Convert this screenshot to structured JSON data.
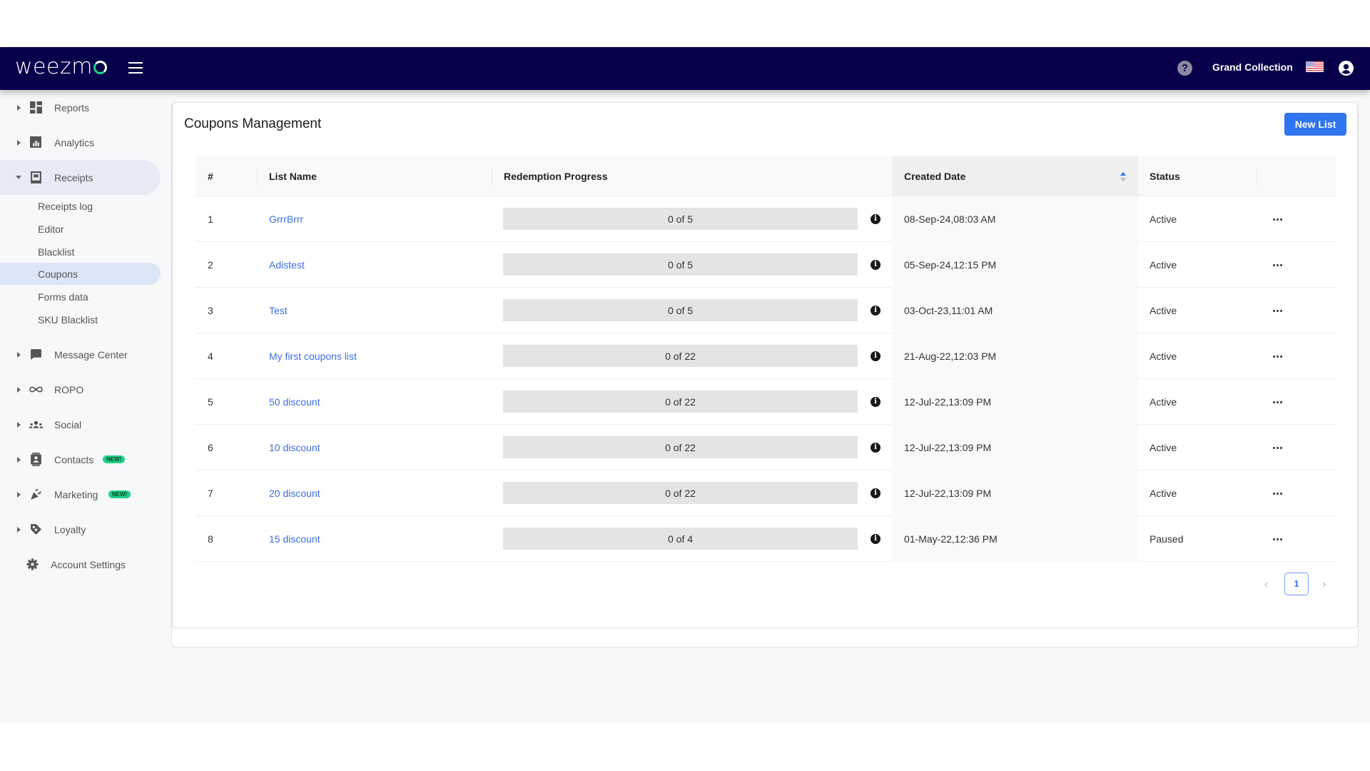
{
  "header": {
    "logo_text": "weezm",
    "account_name": "Grand Collection",
    "icons": [
      "menu-icon",
      "help-icon",
      "us-flag-icon",
      "user-account-icon"
    ]
  },
  "sidebar": {
    "items": [
      {
        "label": "Reports",
        "icon": "dashboard-icon",
        "expanded": false
      },
      {
        "label": "Analytics",
        "icon": "bar-chart-icon",
        "expanded": false
      },
      {
        "label": "Receipts",
        "icon": "receipt-icon",
        "expanded": true
      },
      {
        "label": "Message Center",
        "icon": "chat-icon",
        "expanded": false
      },
      {
        "label": "ROPO",
        "icon": "infinity-icon",
        "expanded": false
      },
      {
        "label": "Social",
        "icon": "people-icon",
        "expanded": false
      },
      {
        "label": "Contacts",
        "icon": "contact-card-icon",
        "expanded": false,
        "badge": "NEW!"
      },
      {
        "label": "Marketing",
        "icon": "party-popper-icon",
        "expanded": false,
        "badge": "NEW!"
      },
      {
        "label": "Loyalty",
        "icon": "tag-icon",
        "expanded": false
      },
      {
        "label": "Account Settings",
        "icon": "gear-icon"
      }
    ],
    "receipts_sub": [
      {
        "label": "Receipts log"
      },
      {
        "label": "Editor"
      },
      {
        "label": "Blacklist"
      },
      {
        "label": "Coupons",
        "active": true
      },
      {
        "label": "Forms data"
      },
      {
        "label": "SKU Blacklist"
      }
    ]
  },
  "main": {
    "title": "Coupons Management",
    "new_list_label": "New List",
    "table": {
      "columns": [
        "#",
        "List Name",
        "Redemption Progress",
        "Created Date",
        "Status"
      ],
      "sorted_by": "Created Date",
      "rows": [
        {
          "num": "1",
          "name": "GrrrBrrr",
          "progress_text": "0 of 5",
          "redeemed": 0,
          "total": 5,
          "created": "08-Sep-24,08:03 AM",
          "status": "Active"
        },
        {
          "num": "2",
          "name": "Adistest",
          "progress_text": "0 of 5",
          "redeemed": 0,
          "total": 5,
          "created": "05-Sep-24,12:15 PM",
          "status": "Active"
        },
        {
          "num": "3",
          "name": "Test",
          "progress_text": "0 of 5",
          "redeemed": 0,
          "total": 5,
          "created": "03-Oct-23,11:01 AM",
          "status": "Active"
        },
        {
          "num": "4",
          "name": "My first coupons list",
          "progress_text": "0 of 22",
          "redeemed": 0,
          "total": 22,
          "created": "21-Aug-22,12:03 PM",
          "status": "Active"
        },
        {
          "num": "5",
          "name": "50 discount",
          "progress_text": "0 of 22",
          "redeemed": 0,
          "total": 22,
          "created": "12-Jul-22,13:09 PM",
          "status": "Active"
        },
        {
          "num": "6",
          "name": "10 discount",
          "progress_text": "0 of 22",
          "redeemed": 0,
          "total": 22,
          "created": "12-Jul-22,13:09 PM",
          "status": "Active"
        },
        {
          "num": "7",
          "name": "20 discount",
          "progress_text": "0 of 22",
          "redeemed": 0,
          "total": 22,
          "created": "12-Jul-22,13:09 PM",
          "status": "Active"
        },
        {
          "num": "8",
          "name": "15 discount",
          "progress_text": "0 of 4",
          "redeemed": 0,
          "total": 4,
          "created": "01-May-22,12:36 PM",
          "status": "Paused"
        }
      ]
    },
    "pagination": {
      "current_page": "1",
      "prev": "‹",
      "next": "›"
    }
  },
  "colors": {
    "header_bg": "#07004a",
    "accent": "#2f74f0",
    "badge_new": "#1fd18a",
    "link": "#3d6fe0"
  }
}
